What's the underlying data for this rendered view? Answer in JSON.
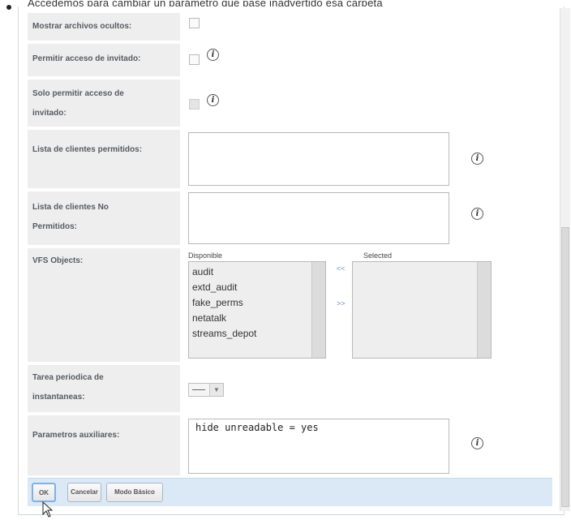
{
  "caption": "Accedemos para cambiar un parámetro que pase inadvertido esa carpeta",
  "form": {
    "show_hidden_files": {
      "label": "Mostrar archivos ocultos:",
      "checked": false
    },
    "guest_access": {
      "label": "Permitir acceso de invitado:",
      "checked": false,
      "info": "i"
    },
    "guest_only": {
      "label_line1": "Solo permitir acceso de",
      "label_line2": "invitado:",
      "checked": false,
      "disabled": true,
      "info": "i"
    },
    "allowed_hosts": {
      "label": "Lista de clientes permitidos:",
      "value": "",
      "info": "i"
    },
    "denied_hosts": {
      "label_line1": "Lista de clientes No",
      "label_line2": "Permitidos:",
      "value": "",
      "info": "i"
    },
    "vfs_objects": {
      "label": "VFS Objects:",
      "available_title": "Disponible",
      "selected_title": "Selected",
      "available": [
        "audit",
        "extd_audit",
        "fake_perms",
        "netatalk",
        "streams_depot"
      ],
      "selected": [],
      "add_button": ">>",
      "remove_button": "<<"
    },
    "snapshot_task": {
      "label_line1": "Tarea periodica de",
      "label_line2": "instantaneas:",
      "value": "—"
    },
    "aux_params": {
      "label": "Parametros auxiliares:",
      "value": "hide unreadable = yes",
      "info": "i"
    }
  },
  "footer": {
    "ok_label": "OK",
    "cancel_label": "Cancelar",
    "basic_mode_label": "Modo Básico"
  },
  "colors": {
    "label_bg": "#eeeeee",
    "footer_bg": "#dbe9f7",
    "primary_border": "#7fb1e4",
    "move_button": "#6b8fc2"
  }
}
